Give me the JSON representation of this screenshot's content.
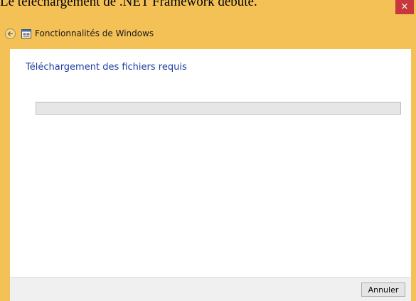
{
  "caption": "Le téléchargement de .NET Framework débute.",
  "window": {
    "title": "Fonctionnalités de Windows",
    "close_symbol": "×",
    "heading": "Téléchargement des fichiers requis",
    "progress": 0,
    "cancel_label": "Annuler",
    "icons": {
      "back": "back-arrow-icon",
      "app": "windows-features-icon",
      "close": "close-icon"
    }
  }
}
